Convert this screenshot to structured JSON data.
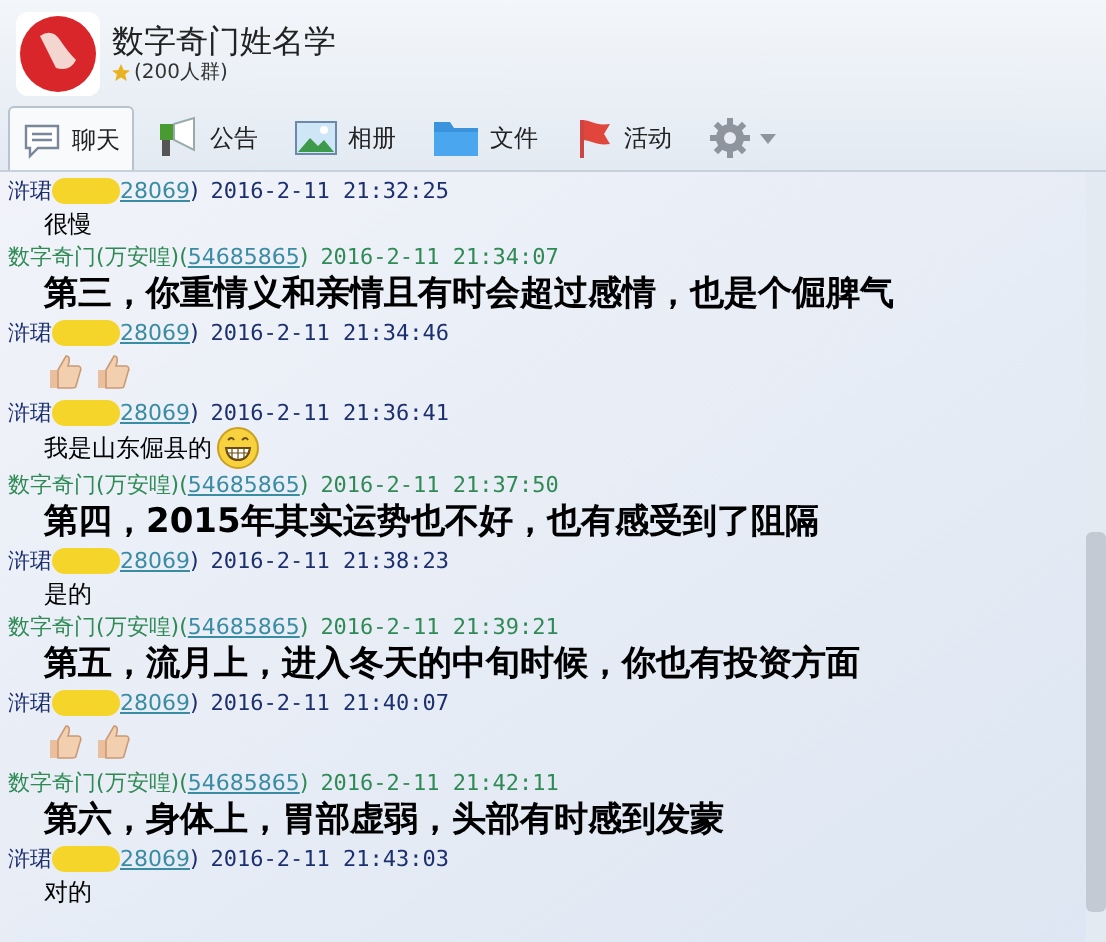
{
  "group": {
    "name": "数字奇门姓名学",
    "member_count": "(200人群)"
  },
  "tabs": [
    {
      "label": "聊天",
      "kind": "chat",
      "selected": true
    },
    {
      "label": "公告",
      "kind": "notice",
      "selected": false
    },
    {
      "label": "相册",
      "kind": "album",
      "selected": false
    },
    {
      "label": "文件",
      "kind": "files",
      "selected": false
    },
    {
      "label": "活动",
      "kind": "events",
      "selected": false
    },
    {
      "kind": "settings",
      "selected": false
    }
  ],
  "messages": [
    {
      "sender": {
        "kind": "member",
        "name": "浒珺",
        "redacted": true,
        "id": "28069",
        "id_close": ")",
        "time": "2016-2-11 21:32:25"
      },
      "body": {
        "kind": "text",
        "text": "很慢"
      }
    },
    {
      "sender": {
        "kind": "owner",
        "name": "数字奇门(万安喤)",
        "id_open": "(",
        "id": "54685865",
        "id_close": ")",
        "time": "2016-2-11 21:34:07"
      },
      "body": {
        "kind": "bold",
        "text": "第三，你重情义和亲情且有时会超过感情，也是个倔脾气"
      }
    },
    {
      "sender": {
        "kind": "member",
        "name": "浒珺",
        "redacted": true,
        "id": "28069",
        "id_close": ")",
        "time": "2016-2-11 21:34:46"
      },
      "body": {
        "kind": "thumbs"
      }
    },
    {
      "sender": {
        "kind": "member",
        "name": "浒珺",
        "redacted": true,
        "id": "28069",
        "id_close": ")",
        "time": "2016-2-11 21:36:41"
      },
      "body": {
        "kind": "text_grin",
        "text": "我是山东倔县的"
      }
    },
    {
      "sender": {
        "kind": "owner",
        "name": "数字奇门(万安喤)",
        "id_open": "(",
        "id": "54685865",
        "id_close": ")",
        "time": "2016-2-11 21:37:50"
      },
      "body": {
        "kind": "bold",
        "text": "第四，2015年其实运势也不好，也有感受到了阻隔"
      }
    },
    {
      "sender": {
        "kind": "member",
        "name": "浒珺",
        "redacted": true,
        "id": "28069",
        "id_close": ")",
        "time": "2016-2-11 21:38:23"
      },
      "body": {
        "kind": "text",
        "text": "是的"
      }
    },
    {
      "sender": {
        "kind": "owner",
        "name": "数字奇门(万安喤)",
        "id_open": "(",
        "id": "54685865",
        "id_close": ")",
        "time": "2016-2-11 21:39:21"
      },
      "body": {
        "kind": "bold",
        "text": "第五，流月上，进入冬天的中旬时候，你也有投资方面"
      }
    },
    {
      "sender": {
        "kind": "member",
        "name": "浒珺",
        "redacted": true,
        "id": "28069",
        "id_close": ")",
        "time": "2016-2-11 21:40:07"
      },
      "body": {
        "kind": "thumbs"
      }
    },
    {
      "sender": {
        "kind": "owner",
        "name": "数字奇门(万安喤)",
        "id_open": "(",
        "id": "54685865",
        "id_close": ")",
        "time": "2016-2-11 21:42:11"
      },
      "body": {
        "kind": "bold",
        "text": "第六，身体上，胃部虚弱，头部有时感到发蒙"
      }
    },
    {
      "sender": {
        "kind": "member",
        "name": "浒珺",
        "redacted": true,
        "id": "28069",
        "id_close": ")",
        "time": "2016-2-11 21:43:03"
      },
      "body": {
        "kind": "text",
        "text": "对的"
      }
    }
  ]
}
